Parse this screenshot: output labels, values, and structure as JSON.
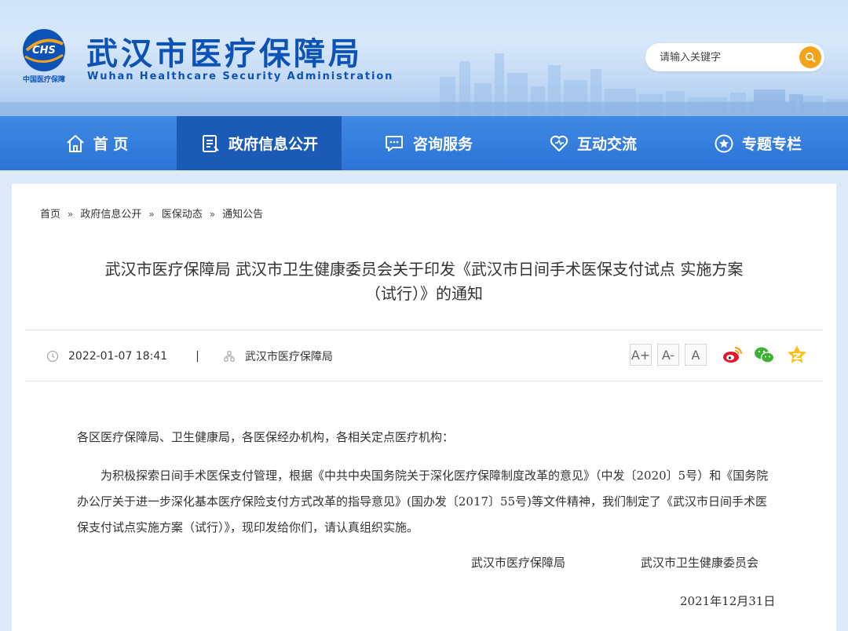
{
  "header": {
    "logo_text": "CHS",
    "logo_caption": "中国医疗保障",
    "title": "武汉市医疗保障局",
    "subtitle": "Wuhan Healthcare Security Administration",
    "search_placeholder": "请输入关键字"
  },
  "nav": {
    "items": [
      {
        "label": "首 页",
        "icon": "home-icon"
      },
      {
        "label": "政府信息公开",
        "icon": "document-icon",
        "active": true
      },
      {
        "label": "咨询服务",
        "icon": "chat-icon"
      },
      {
        "label": "互动交流",
        "icon": "heart-icon"
      },
      {
        "label": "专题专栏",
        "icon": "star-icon"
      }
    ]
  },
  "breadcrumb": {
    "items": [
      "首页",
      "政府信息公开",
      "医保动态",
      "通知公告"
    ],
    "separator": "»"
  },
  "article": {
    "title_line1": "武汉市医疗保障局 武汉市卫生健康委员会关于印发《武汉市日间手术医保支付试点 实施方案",
    "title_line2": "（试行）》的通知",
    "date": "2022-01-07 18:41",
    "divider": "|",
    "source": "武汉市医疗保障局",
    "font_sizes": [
      "A+",
      "A-",
      "A"
    ],
    "share_icons": [
      "weibo-icon",
      "wechat-icon",
      "qzone-icon"
    ],
    "salutation": "各区医疗保障局、卫生健康局，各医保经办机构，各相关定点医疗机构：",
    "paragraph": "为积极探索日间手术医保支付管理，根据《中共中央国务院关于深化医疗保障制度改革的意见》（中发〔2020〕5号）和《国务院办公厅关于进一步深化基本医疗保险支付方式改革的指导意见》(国办发〔2017〕55号)等文件精神，我们制定了《武汉市日间手术医保支付试点实施方案（试行）》，现印发给你们，请认真组织实施。",
    "signer1": "武汉市医疗保障局",
    "signer2": "武汉市卫生健康委员会",
    "sign_date": "2021年12月31日"
  },
  "colors": {
    "brand_blue": "#0d52b5",
    "nav_blue": "#2c73d6",
    "nav_active": "#1b5bb6",
    "search_orange": "#f5a21c"
  }
}
